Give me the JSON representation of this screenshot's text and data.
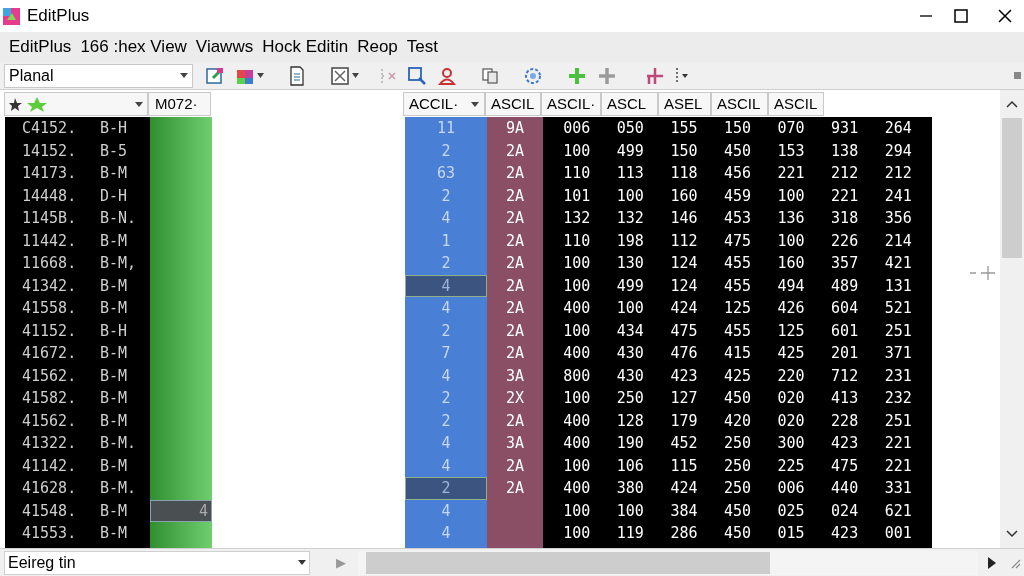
{
  "window": {
    "title": "EditPlus"
  },
  "menu": [
    "EditPlus",
    "166 :hex View",
    "Viawws",
    "Hock Editin",
    "Reop",
    "Test"
  ],
  "toolbar": {
    "combo": "Planal"
  },
  "left_header": {
    "value": "M072·"
  },
  "columns": [
    "ACCIL·",
    "ASCIL",
    "ASCIL·",
    "ASCL",
    "ASEL",
    "ASCIL",
    "ASCIL"
  ],
  "rows": [
    {
      "address": "C4152.",
      "code": "B-H",
      "key": "11",
      "key_selected": false,
      "tag": "9A",
      "values": [
        "006",
        "050",
        "155",
        "150",
        "070",
        "931",
        "264"
      ]
    },
    {
      "address": "14152.",
      "code": "B-5",
      "key": "2",
      "key_selected": false,
      "tag": "2A",
      "values": [
        "100",
        "499",
        "150",
        "450",
        "153",
        "138",
        "294"
      ]
    },
    {
      "address": "14173.",
      "code": "B-M",
      "key": "63",
      "key_selected": false,
      "tag": "2A",
      "values": [
        "110",
        "113",
        "118",
        "456",
        "221",
        "212",
        "212"
      ]
    },
    {
      "address": "14448.",
      "code": "D-H",
      "key": "2",
      "key_selected": false,
      "tag": "2A",
      "values": [
        "101",
        "100",
        "160",
        "459",
        "100",
        "221",
        "241"
      ]
    },
    {
      "address": "1145B.",
      "code": "B-N.",
      "key": "4",
      "key_selected": false,
      "tag": "2A",
      "values": [
        "132",
        "132",
        "146",
        "453",
        "136",
        "318",
        "356"
      ]
    },
    {
      "address": "11442.",
      "code": "B-M",
      "key": "1",
      "key_selected": false,
      "tag": "2A",
      "values": [
        "110",
        "198",
        "112",
        "475",
        "100",
        "226",
        "214"
      ]
    },
    {
      "address": "11668.",
      "code": "B-M,",
      "key": "2",
      "key_selected": false,
      "tag": "2A",
      "values": [
        "100",
        "130",
        "124",
        "455",
        "160",
        "357",
        "421"
      ]
    },
    {
      "address": "41342.",
      "code": "B-M",
      "key": "4",
      "key_selected": true,
      "tag": "2A",
      "values": [
        "100",
        "499",
        "124",
        "455",
        "494",
        "489",
        "131"
      ]
    },
    {
      "address": "41558.",
      "code": "B-M",
      "key": "4",
      "key_selected": false,
      "tag": "2A",
      "values": [
        "400",
        "100",
        "424",
        "125",
        "426",
        "604",
        "521"
      ]
    },
    {
      "address": "41152.",
      "code": "B-H",
      "key": "2",
      "key_selected": false,
      "tag": "2A",
      "values": [
        "100",
        "434",
        "475",
        "455",
        "125",
        "601",
        "251"
      ]
    },
    {
      "address": "41672.",
      "code": "B-M",
      "key": "7",
      "key_selected": false,
      "tag": "2A",
      "values": [
        "400",
        "430",
        "476",
        "415",
        "425",
        "201",
        "371"
      ]
    },
    {
      "address": "41562.",
      "code": "B-M",
      "key": "4",
      "key_selected": false,
      "tag": "3A",
      "values": [
        "800",
        "430",
        "423",
        "425",
        "220",
        "712",
        "231"
      ]
    },
    {
      "address": "41582.",
      "code": "B-M",
      "key": "2",
      "key_selected": false,
      "tag": "2X",
      "values": [
        "100",
        "250",
        "127",
        "450",
        "020",
        "413",
        "232"
      ]
    },
    {
      "address": "41562.",
      "code": "B-M",
      "key": "2",
      "key_selected": false,
      "tag": "2A",
      "values": [
        "400",
        "128",
        "179",
        "420",
        "020",
        "228",
        "251"
      ]
    },
    {
      "address": "41322.",
      "code": "B-M.",
      "key": "4",
      "key_selected": false,
      "tag": "3A",
      "values": [
        "400",
        "190",
        "452",
        "250",
        "300",
        "423",
        "221"
      ]
    },
    {
      "address": "41142.",
      "code": "B-M",
      "key": "4",
      "key_selected": false,
      "tag": "2A",
      "values": [
        "100",
        "106",
        "115",
        "250",
        "225",
        "475",
        "221"
      ]
    },
    {
      "address": "41628.",
      "code": "B-M.",
      "key": "2",
      "key_selected": true,
      "tag": "2A",
      "values": [
        "400",
        "380",
        "424",
        "250",
        "006",
        "440",
        "331"
      ]
    },
    {
      "address": "41548.",
      "code": "B-M",
      "side_value": "4",
      "key": "4",
      "key_selected": false,
      "values": [
        "100",
        "100",
        "384",
        "450",
        "025",
        "024",
        "621"
      ]
    },
    {
      "address": "41553.",
      "code": "B-M",
      "key": "4",
      "key_selected": false,
      "values": [
        "100",
        "119",
        "286",
        "450",
        "015",
        "423",
        "001"
      ]
    }
  ],
  "status_bar": {
    "combo": "Eeireg tin",
    "arrow": "▶"
  }
}
